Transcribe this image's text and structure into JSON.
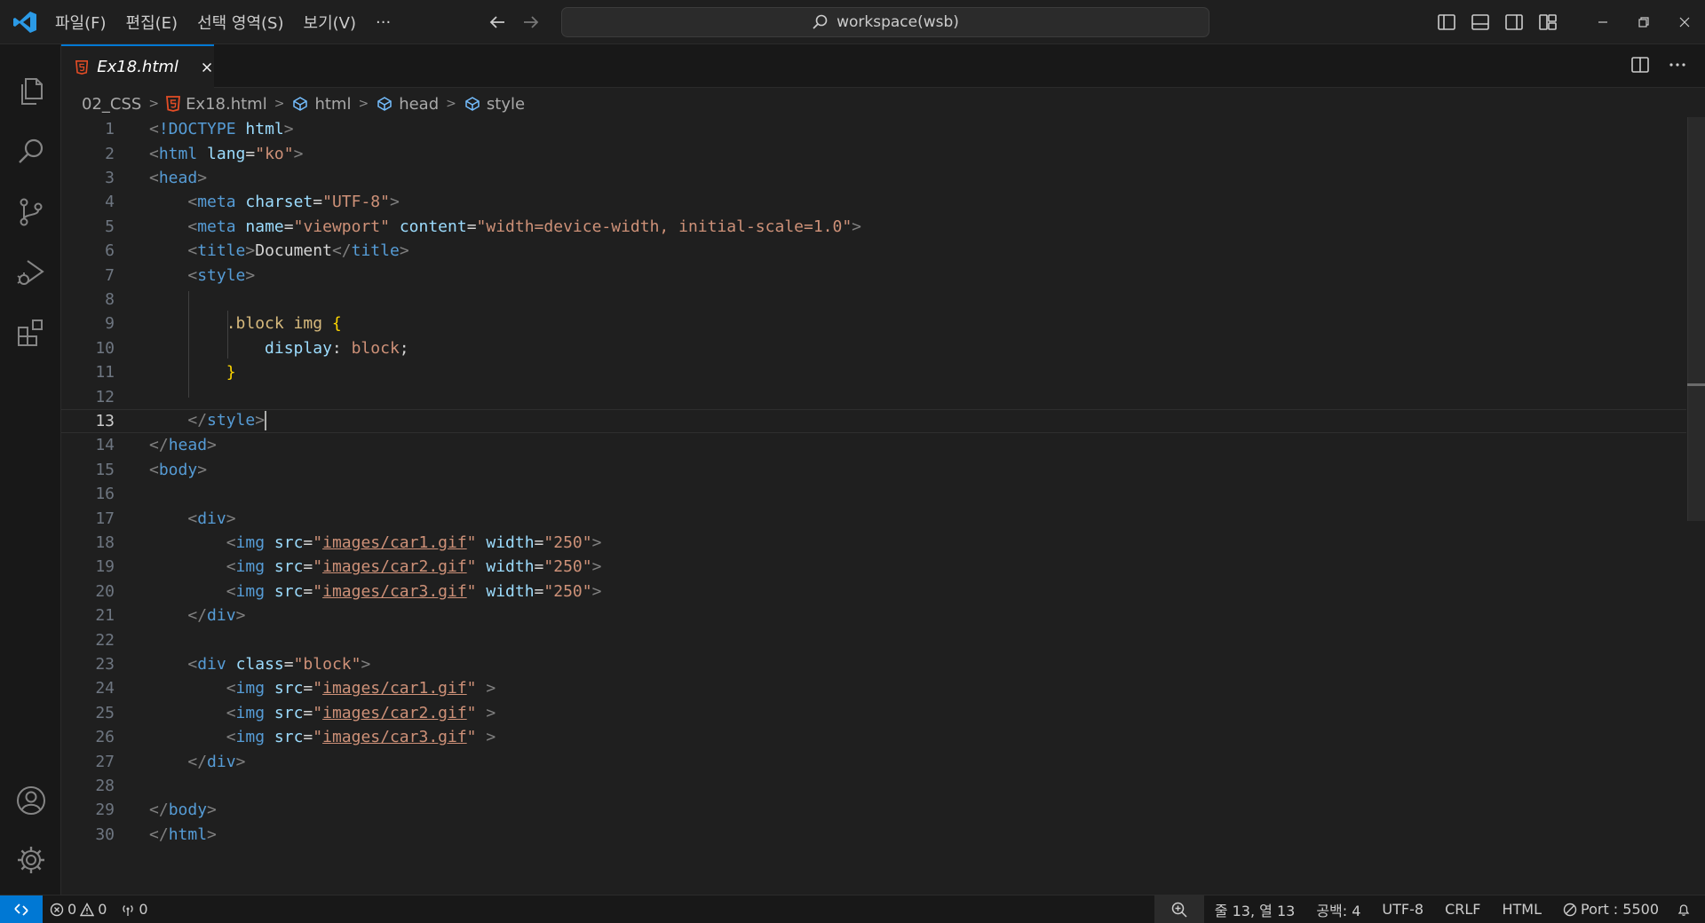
{
  "titlebar": {
    "menu": [
      "파일(F)",
      "편집(E)",
      "선택 영역(S)",
      "보기(V)",
      "···"
    ],
    "search_text": "workspace(wsb)"
  },
  "tab": {
    "label": "Ex18.html"
  },
  "breadcrumb": [
    "02_CSS",
    "Ex18.html",
    "html",
    "head",
    "style"
  ],
  "editor": {
    "current_line": 13,
    "lines": [
      "1",
      "2",
      "3",
      "4",
      "5",
      "6",
      "7",
      "8",
      "9",
      "10",
      "11",
      "12",
      "13",
      "14",
      "15",
      "16",
      "17",
      "18",
      "19",
      "20",
      "21",
      "22",
      "23",
      "24",
      "25",
      "26",
      "27",
      "28",
      "29",
      "30"
    ],
    "code": {
      "l1a": "<!DOCTYPE",
      "l1b": "html",
      "l1c": ">",
      "lang_val": "\"ko\"",
      "charset_val": "\"UTF-8\"",
      "viewport_val": "\"viewport\"",
      "content_val": "\"width=device-width, initial-scale=1.0\"",
      "title_text": "Document",
      "css_selector": ".block img",
      "css_prop": "display",
      "css_value": "block",
      "car1": "images/car1.gif",
      "car2": "images/car2.gif",
      "car3": "images/car3.gif",
      "width_val": "\"250\"",
      "class_val": "\"block\""
    }
  },
  "statusbar": {
    "errors": "0",
    "warnings": "0",
    "ports": "0",
    "position": "줄 13, 열 13",
    "spaces": "공백: 4",
    "encoding": "UTF-8",
    "eol": "CRLF",
    "language": "HTML",
    "port": "Port : 5500"
  },
  "colors": {
    "accent": "#0078d4",
    "html_icon": "#e44d26"
  }
}
